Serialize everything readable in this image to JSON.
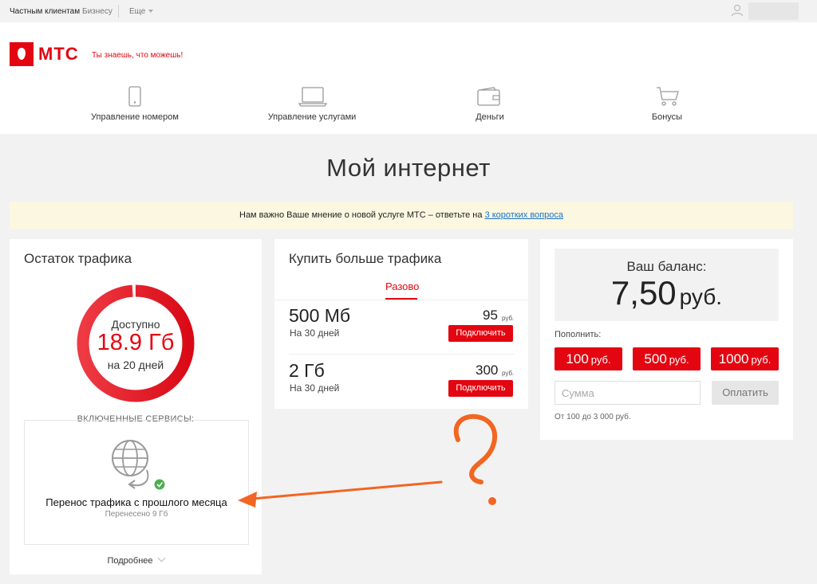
{
  "topbar": {
    "personal": "Частным клиентам",
    "business": "Бизнесу",
    "more": "Еще"
  },
  "header": {
    "logo_text": "МТС",
    "slogan": "Ты знаешь, что можешь!",
    "nav": [
      {
        "label": "Управление номером",
        "icon": "phone-icon"
      },
      {
        "label": "Управление услугами",
        "icon": "laptop-icon"
      },
      {
        "label": "Деньги",
        "icon": "wallet-icon"
      },
      {
        "label": "Бонусы",
        "icon": "cart-icon"
      }
    ]
  },
  "page_title": "Мой интернет",
  "survey": {
    "text": "Нам важно Ваше мнение о новой услуге МТС – ответьте на ",
    "link": "3 коротких вопроса"
  },
  "traffic": {
    "title": "Остаток трафика",
    "available_label": "Доступно",
    "amount": "18.9 Гб",
    "days": "на 20 дней",
    "remaining_fraction": 0.99,
    "services_caption": "ВКЛЮЧЕННЫЕ СЕРВИСЫ:",
    "service_name": "Перенос трафика с прошлого месяца",
    "service_sub": "Перенесено 9 Гб",
    "more": "Подробнее"
  },
  "buy": {
    "title": "Купить больше трафика",
    "tab": "Разово",
    "packages": [
      {
        "size": "500 Мб",
        "days": "На 30 дней",
        "price": "95",
        "currency": "руб.",
        "button": "Подключить"
      },
      {
        "size": "2 Гб",
        "days": "На 30 дней",
        "price": "300",
        "currency": "руб.",
        "button": "Подключить"
      }
    ]
  },
  "balance": {
    "label": "Ваш баланс:",
    "value": "7,50",
    "currency": "руб.",
    "topup_label": "Пополнить:",
    "amounts": [
      {
        "value": "100",
        "currency": "руб."
      },
      {
        "value": "500",
        "currency": "руб."
      },
      {
        "value": "1000",
        "currency": "руб."
      }
    ],
    "sum_placeholder": "Сумма",
    "pay_button": "Оплатить",
    "range_note": "От 100 до 3 000 руб."
  },
  "colors": {
    "brand_red": "#e30611",
    "annotation_orange": "#f26522",
    "survey_bg": "#fbf7e1"
  }
}
